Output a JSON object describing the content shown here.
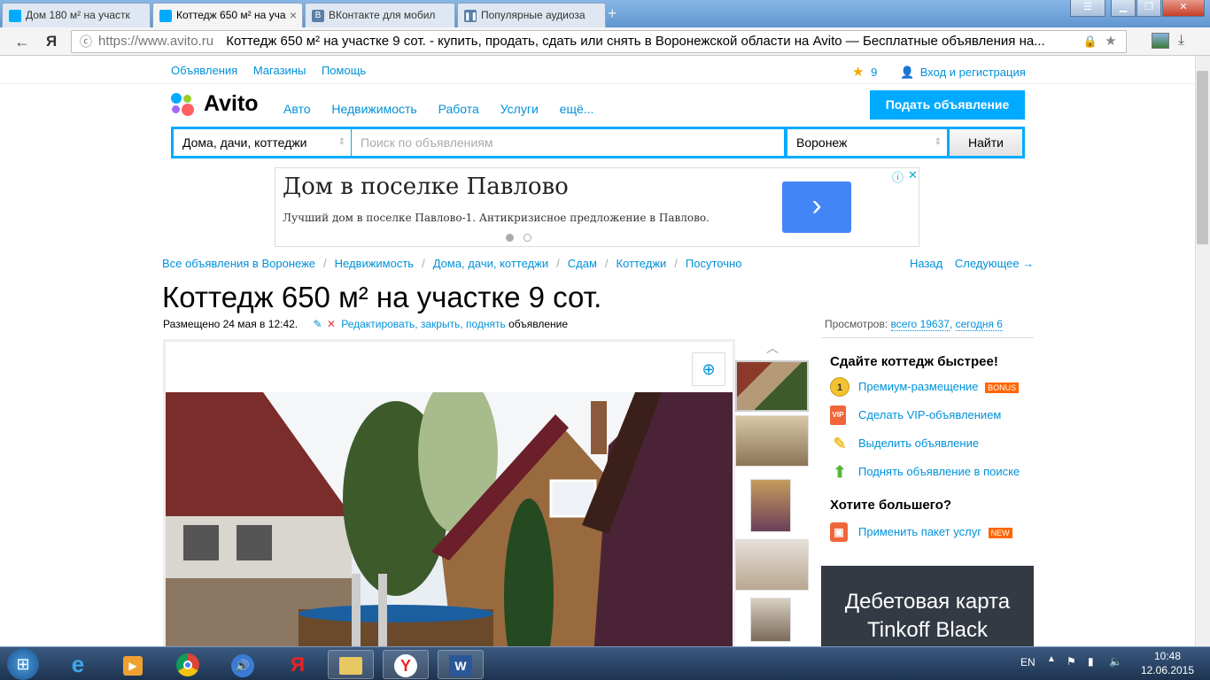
{
  "browser": {
    "tabs": [
      {
        "label": "Дом 180 м² на участк",
        "active": false
      },
      {
        "label": "Коттедж 650 м² на уча",
        "active": true
      },
      {
        "label": "ВКонтакте для мобил",
        "active": false
      },
      {
        "label": "Популярные аудиоза",
        "active": false
      }
    ],
    "url": "https://www.avito.ru",
    "page_title": "Коттедж 650 м² на участке 9 сот. - купить, продать, сдать или снять в Воронежской области на Avito — Бесплатные объявления на...",
    "yandex_glyph": "Я"
  },
  "topnav": {
    "ads": "Объявления",
    "shops": "Магазины",
    "help": "Помощь",
    "fav_count": "9",
    "login": "Вход и регистрация"
  },
  "header": {
    "logo": "Avito",
    "nav": [
      "Авто",
      "Недвижимость",
      "Работа",
      "Услуги",
      "ещё..."
    ],
    "post_button": "Подать объявление"
  },
  "search": {
    "category": "Дома, дачи, коттеджи",
    "placeholder": "Поиск по объявлениям",
    "location": "Воронеж",
    "button": "Найти"
  },
  "ad_banner": {
    "title": "Дом в поселке Павлово",
    "text": "Лучший дом в поселке Павлово-1. Антикризисное предложение в Павлово."
  },
  "breadcrumbs": [
    "Все объявления в Воронеже",
    "Недвижимость",
    "Дома, дачи, коттеджи",
    "Сдам",
    "Коттеджи",
    "Посуточно"
  ],
  "pager": {
    "back": "Назад",
    "next": "Следующее →"
  },
  "listing": {
    "title": "Коттедж 650 м² на участке 9 сот.",
    "posted": "Размещено 24 мая в 12:42.",
    "edit": "Редактировать, закрыть, поднять",
    "edit_suffix": "объявление",
    "views_label": "Просмотров:",
    "views_total": "всего 19637",
    "views_today": "сегодня 6"
  },
  "sidebar": {
    "head1": "Сдайте коттедж быстрее!",
    "premium": "Премиум-размещение",
    "bonus": "BONUS",
    "vip": "Сделать VIP-объявлением",
    "highlight": "Выделить объявление",
    "raise": "Поднять объявление в поиске",
    "head2": "Хотите большего?",
    "package": "Применить пакет услуг",
    "new": "NEW"
  },
  "promo": {
    "line1": "Дебетовая карта",
    "line2": "Tinkoff Black"
  },
  "taskbar": {
    "lang": "EN",
    "time": "10:48",
    "date": "12.06.2015"
  },
  "colors": {
    "accent": "#00aaff",
    "link": "#0091d9"
  }
}
